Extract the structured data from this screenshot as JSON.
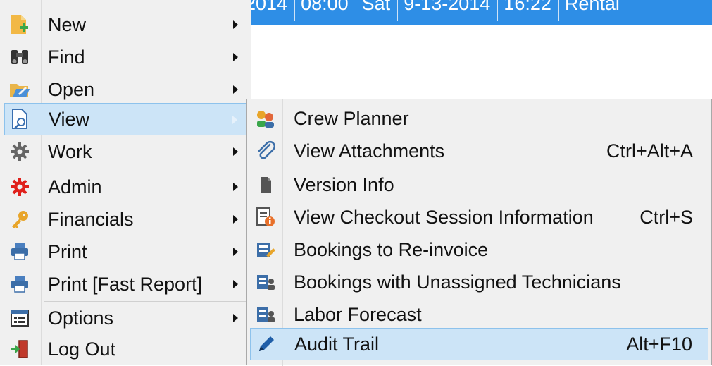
{
  "background_row": {
    "cells": [
      "2014",
      "08:00",
      "Sat",
      "9-13-2014",
      "16:22",
      "Rental"
    ]
  },
  "main_menu": {
    "items": [
      {
        "label": "New",
        "icon": "new-document-icon"
      },
      {
        "label": "Find",
        "icon": "binoculars-icon"
      },
      {
        "label": "Open",
        "icon": "open-folder-icon"
      },
      {
        "label": "View",
        "icon": "view-document-icon"
      },
      {
        "label": "Work",
        "icon": "gear-icon"
      },
      {
        "label": "Admin",
        "icon": "admin-gear-icon"
      },
      {
        "label": "Financials",
        "icon": "key-icon"
      },
      {
        "label": "Print",
        "icon": "printer-icon"
      },
      {
        "label": "Print [Fast Report]",
        "icon": "printer-icon"
      },
      {
        "label": "Options",
        "icon": "options-icon"
      },
      {
        "label": "Log Out",
        "icon": "logout-door-icon"
      }
    ]
  },
  "view_submenu": {
    "items": [
      {
        "label": "Crew Planner",
        "shortcut": "",
        "icon": "crew-icon"
      },
      {
        "label": "View Attachments",
        "shortcut": "Ctrl+Alt+A",
        "icon": "paperclip-icon"
      },
      {
        "label": "Version Info",
        "shortcut": "",
        "icon": "version-info-icon"
      },
      {
        "label": "View Checkout Session Information",
        "shortcut": "Ctrl+S",
        "icon": "info-document-icon"
      },
      {
        "label": "Bookings to Re-invoice",
        "shortcut": "",
        "icon": "reinvoice-icon"
      },
      {
        "label": "Bookings with Unassigned Technicians",
        "shortcut": "",
        "icon": "technicians-icon"
      },
      {
        "label": "Labor Forecast",
        "shortcut": "",
        "icon": "labor-forecast-icon"
      },
      {
        "label": "Audit Trail",
        "shortcut": "Alt+F10",
        "icon": "pencil-icon"
      }
    ]
  },
  "colors": {
    "menu_bg": "#f0f0f0",
    "highlight_bg": "#cce4f7",
    "highlight_border": "#8dc2ec",
    "grid_selection": "#2e8ee6"
  }
}
